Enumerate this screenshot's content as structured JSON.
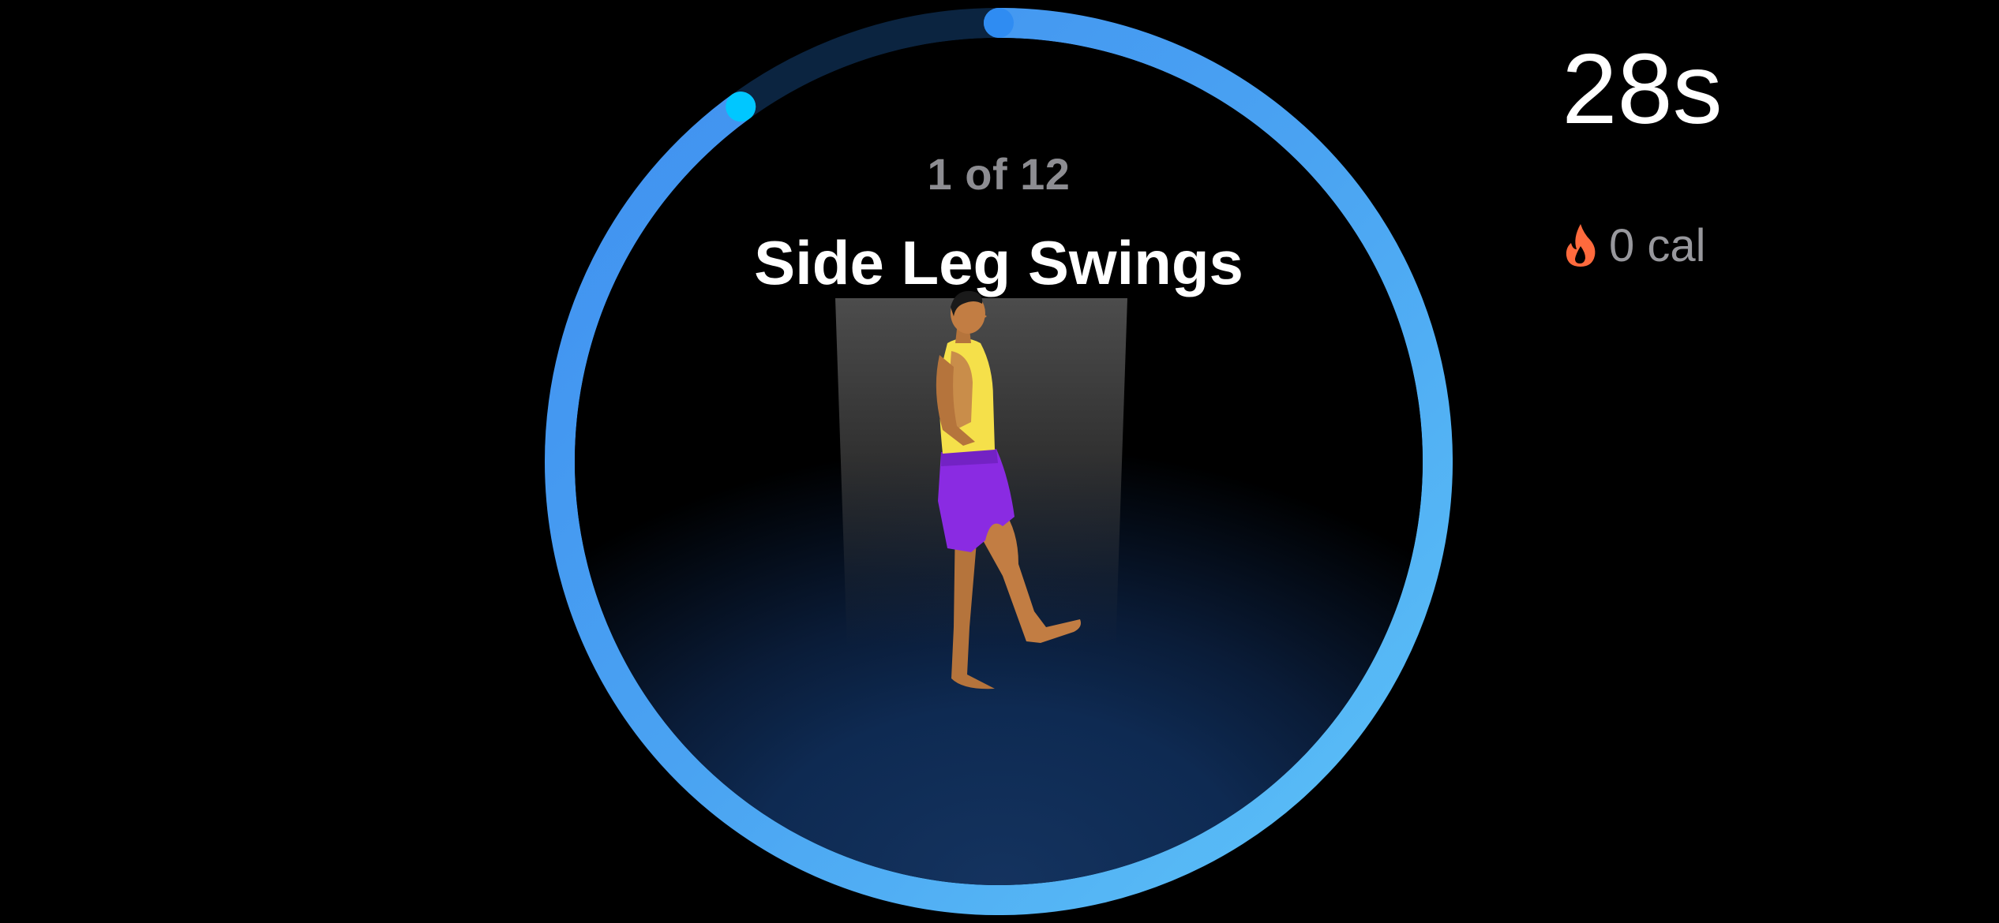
{
  "workout": {
    "counter": "1 of 12",
    "exercise_name": "Side Leg Swings",
    "time_remaining": "28s",
    "calories": "0 cal",
    "progress_fraction": 0.9
  },
  "icons": {
    "calories": "flame-icon"
  },
  "colors": {
    "background": "#000000",
    "ring_start": "#0a84ff",
    "ring_end": "#5ac8fa",
    "ring_track": "#0b2440",
    "ring_tail_dot": "#00c7ff",
    "flame": "#ff6a3d",
    "counter_text": "#8d8d92",
    "calories_text": "#98989d"
  }
}
